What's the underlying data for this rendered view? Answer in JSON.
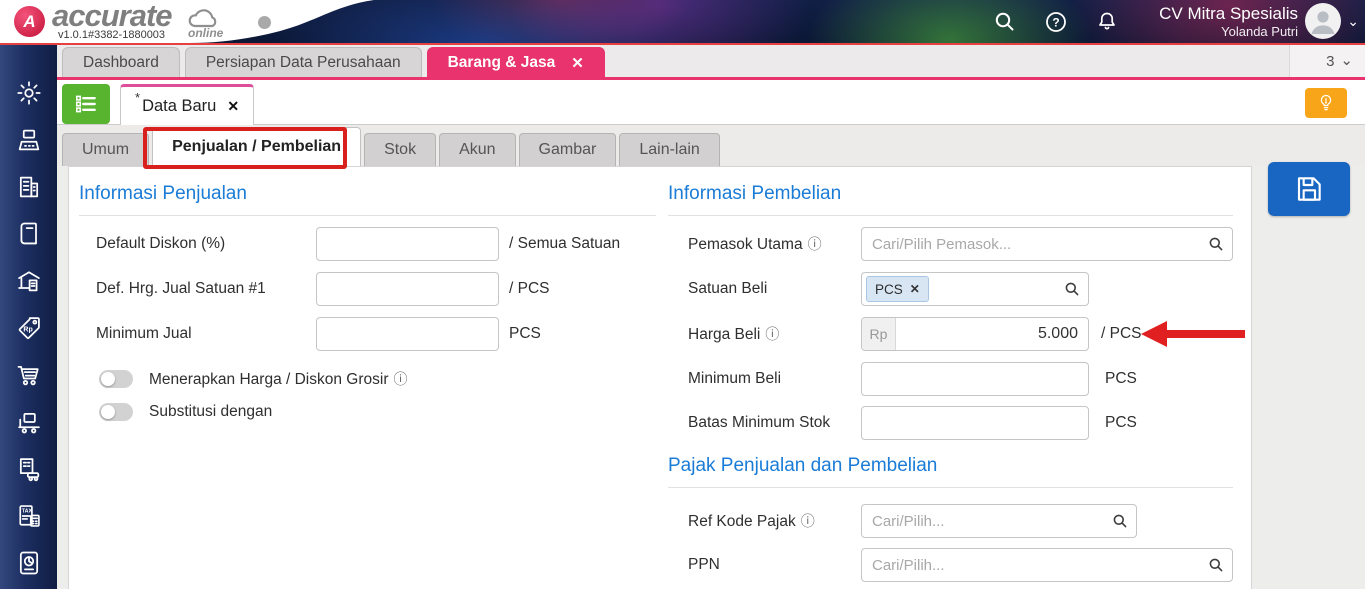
{
  "colors": {
    "accent_pink": "#e8336e",
    "heading_blue": "#1a7cd7",
    "save_blue": "#1866c2",
    "alert_orange": "#f9a51a",
    "annotation_red": "#d8201c",
    "arrow_red": "#e02020",
    "sidebar_navy": "#1c2e60",
    "action_green": "#58b32f"
  },
  "icons": {
    "info": "ⓘ",
    "close": "✕",
    "chevron_down": "⌄",
    "dirty": "*",
    "question": "?",
    "rp_tag": "Rp",
    "tax_label": "TAX"
  },
  "header": {
    "brand": "accurate",
    "brand_sub": "online",
    "version": "v1.0.1#3382-1880003",
    "company": "CV Mitra Spesialis",
    "user": "Yolanda Putri"
  },
  "main_tabs": [
    {
      "label": "Dashboard"
    },
    {
      "label": "Persiapan Data Perusahaan"
    },
    {
      "label": "Barang & Jasa"
    }
  ],
  "tab_overflow": {
    "count": "3"
  },
  "doc_tab": {
    "label": "Data Baru"
  },
  "sub_tabs": [
    {
      "label": "Umum"
    },
    {
      "label": "Penjualan / Pembelian"
    },
    {
      "label": "Stok"
    },
    {
      "label": "Akun"
    },
    {
      "label": "Gambar"
    },
    {
      "label": "Lain-lain"
    }
  ],
  "sidebar": {
    "items": [
      {
        "icon": "settings"
      },
      {
        "icon": "cash-register"
      },
      {
        "icon": "company"
      },
      {
        "icon": "book"
      },
      {
        "icon": "bank"
      },
      {
        "icon": "price-tag"
      },
      {
        "icon": "cart"
      },
      {
        "icon": "delivery"
      },
      {
        "icon": "asset"
      },
      {
        "icon": "tax"
      },
      {
        "icon": "report"
      }
    ]
  },
  "sales": {
    "title": "Informasi Penjualan",
    "default_diskon": {
      "label": "Default Diskon (%)",
      "suffix": "/ Semua Satuan"
    },
    "def_hrg_jual": {
      "label": "Def. Hrg. Jual Satuan #1",
      "suffix": "/ PCS"
    },
    "minimum_jual": {
      "label": "Minimum Jual",
      "suffix": "PCS"
    },
    "toggle_grosir": {
      "label": "Menerapkan Harga / Diskon Grosir"
    },
    "toggle_substitusi": {
      "label": "Substitusi dengan"
    }
  },
  "purchase": {
    "title": "Informasi Pembelian",
    "pemasok": {
      "label": "Pemasok Utama",
      "placeholder": "Cari/Pilih Pemasok..."
    },
    "satuan_beli": {
      "label": "Satuan Beli",
      "chip": "PCS"
    },
    "harga_beli": {
      "label": "Harga Beli",
      "prefix": "Rp",
      "value": "5.000",
      "suffix": "/ PCS"
    },
    "minimum_beli": {
      "label": "Minimum Beli",
      "suffix": "PCS"
    },
    "batas_minimum_stok": {
      "label": "Batas Minimum Stok",
      "suffix": "PCS"
    }
  },
  "tax": {
    "title": "Pajak Penjualan dan Pembelian",
    "ref_kode_pajak": {
      "label": "Ref Kode Pajak",
      "placeholder": "Cari/Pilih..."
    },
    "ppn": {
      "label": "PPN",
      "placeholder": "Cari/Pilih..."
    }
  }
}
